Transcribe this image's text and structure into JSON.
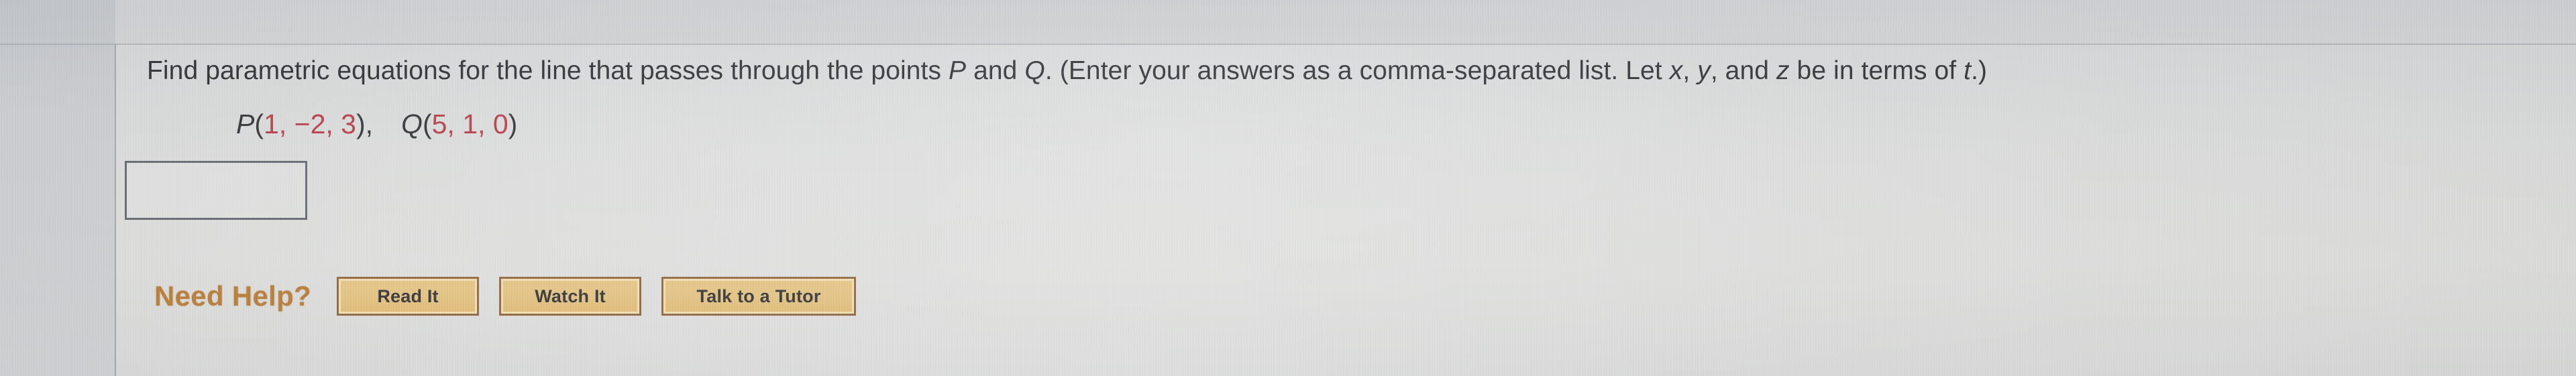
{
  "screen": {
    "background_color": "#d6d7d6",
    "gutter_color": "#c5c7ca"
  },
  "toolbar": {
    "left_box_name": "rounded-toolbar-box",
    "right_box_name": "rounded-toolbar-box",
    "border_color": "#2e3352"
  },
  "question": {
    "prompt_part1": "Find parametric equations for the line that passes through the points ",
    "var_P": "P",
    "prompt_and": " and ",
    "var_Q": "Q",
    "prompt_part2": ". (Enter your answers as a comma-separated list. Let ",
    "var_x": "x",
    "comma1": ", ",
    "var_y": "y",
    "comma2": ", and ",
    "var_z": "z",
    "prompt_part3": " be in terms of ",
    "var_t": "t",
    "prompt_part4": ".)",
    "full_text": "Find parametric equations for the line that passes through the points P and Q. (Enter your answers as a comma-separated list. Let x, y, and z be in terms of t.)"
  },
  "points": {
    "P": {
      "label": "P",
      "open": "(",
      "x": "1",
      "sep1": ", ",
      "y": "−2",
      "sep2": ", ",
      "z": "3",
      "close": "),",
      "coords_text": "P(1, −2, 3),"
    },
    "Q": {
      "label": "Q",
      "open": "(",
      "x": "5",
      "sep1": ", ",
      "y": "1",
      "sep2": ", ",
      "z": "0",
      "close": ")",
      "coords_text": "Q(5, 1, 0)"
    },
    "number_color": "#b1323c"
  },
  "answer": {
    "value": "",
    "placeholder": ""
  },
  "help": {
    "label": "Need Help?",
    "label_color": "#b4762f",
    "buttons": [
      {
        "label": "Read It"
      },
      {
        "label": "Watch It"
      },
      {
        "label": "Talk to a Tutor"
      }
    ],
    "button_fill": "#e2bf7b",
    "button_border": "#8a6038"
  }
}
